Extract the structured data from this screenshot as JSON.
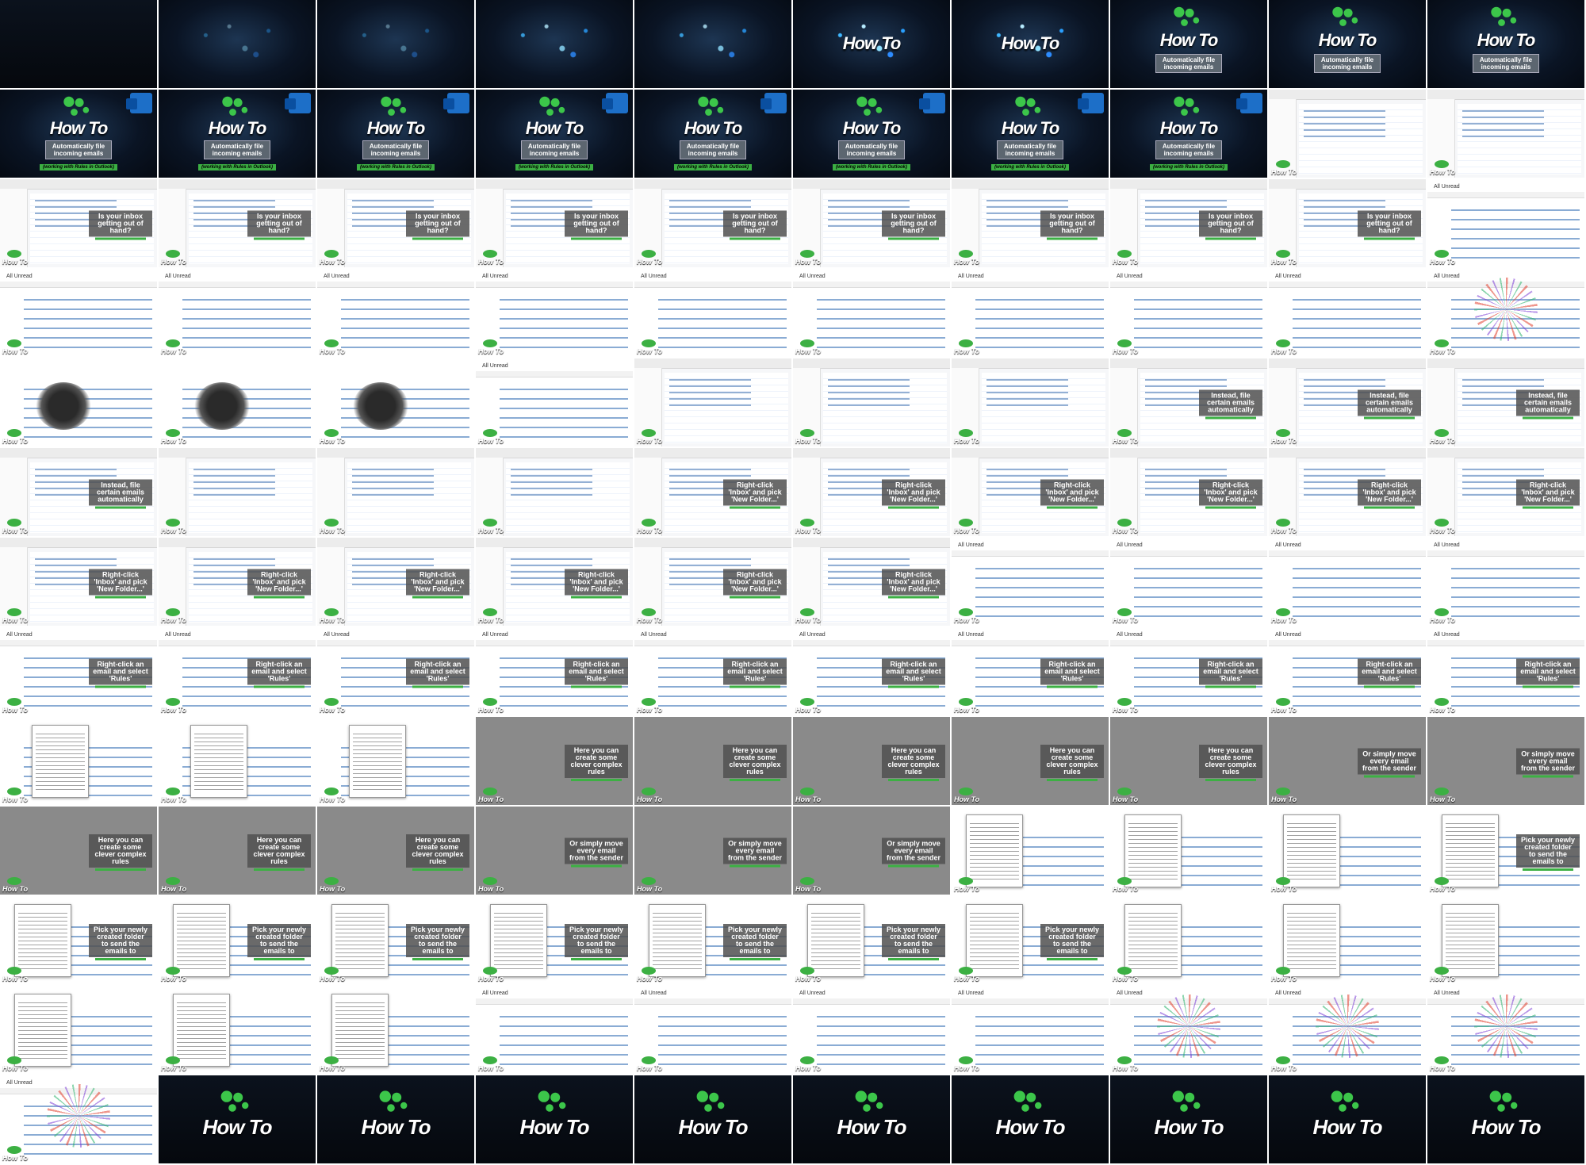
{
  "grid": {
    "columns": 10,
    "rows": 13,
    "frame_count": 123
  },
  "texts": {
    "logo": "How To",
    "title_caption_1": "Automatically file",
    "title_caption_2": "incoming emails",
    "subtitle": "(working with Rules in Outlook)",
    "q1": "Is your inbox getting out of hand?",
    "q2": "Instead, file certain emails automatically",
    "q3": "Right-click 'Inbox' and pick 'New Folder...'",
    "q4": "Right-click an email and select 'Rules'",
    "q5": "Here you can create some clever complex rules",
    "q6": "Or simply move every email from the sender",
    "q7": "Pick your newly created folder to send the emails to"
  },
  "colors": {
    "accent_green": "#3cb043",
    "outlook_blue": "#1d6fc8",
    "dark_bg": "#0a1424"
  }
}
